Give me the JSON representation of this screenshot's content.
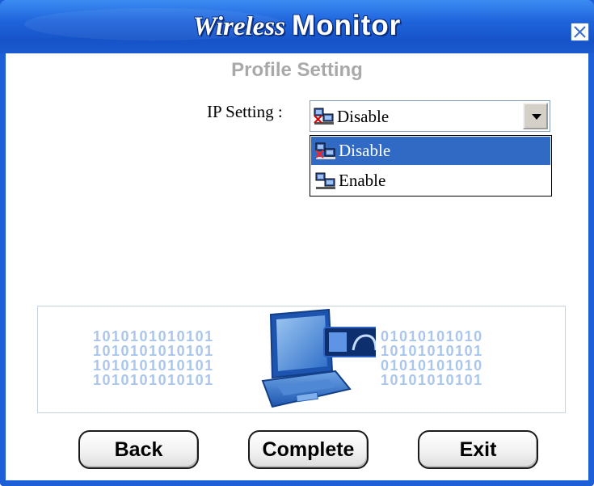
{
  "window": {
    "title_part1": "Wireless",
    "title_part2": "Monitor",
    "close_symbol": "×"
  },
  "header": {
    "subtitle": "Profile Setting"
  },
  "ip_setting": {
    "label": "IP Setting :",
    "selected_value": "Disable",
    "options": [
      {
        "label": "Disable",
        "icon": "network-disabled-icon",
        "highlighted": true
      },
      {
        "label": "Enable",
        "icon": "network-enabled-icon",
        "highlighted": false
      }
    ]
  },
  "banner": {
    "binary_left": [
      "1010101010101",
      "1010101010101",
      "1010101010101",
      "1010101010101"
    ],
    "binary_right": [
      "01010101010",
      "10101010101",
      "01010101010",
      "10101010101"
    ],
    "illustration": "laptop-wireless-card-icon"
  },
  "footer": {
    "back_label": "Back",
    "complete_label": "Complete",
    "exit_label": "Exit"
  },
  "colors": {
    "title_bar": "#1f64dc",
    "selection": "#316ac5",
    "subtitle": "#a9a9a9",
    "binary_dark": "#1f4fa6",
    "binary_light": "#aac6ec"
  }
}
